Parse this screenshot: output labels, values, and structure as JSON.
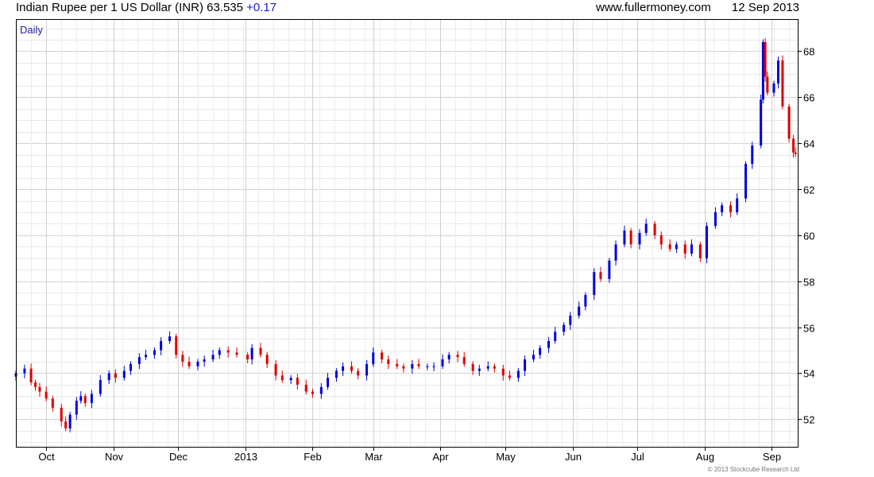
{
  "header": {
    "title": "Indian Rupee per 1 US Dollar (INR) 63.535",
    "change": "+0.17",
    "site": "www.fullermoney.com",
    "date": "12 Sep 2013"
  },
  "footer": {
    "copyright": "© 2013 Stockcube Research Ltd"
  },
  "colors": {
    "up": "#0000dd",
    "down": "#dd0000",
    "grid": "#d8d8d8",
    "label": "#2222aa"
  },
  "chart_data": {
    "type": "candlestick",
    "period_label": "Daily",
    "ylim": [
      50.8,
      69.4
    ],
    "y_ticks": [
      52,
      54,
      56,
      58,
      60,
      62,
      64,
      66,
      68
    ],
    "x_range": [
      "2012-09-17",
      "2013-09-13"
    ],
    "month_ticks": [
      {
        "date": "2012-10-01",
        "label": "Oct"
      },
      {
        "date": "2012-11-01",
        "label": "Nov"
      },
      {
        "date": "2012-12-01",
        "label": "Dec"
      },
      {
        "date": "2013-01-01",
        "label": "2013"
      },
      {
        "date": "2013-02-01",
        "label": "Feb"
      },
      {
        "date": "2013-03-01",
        "label": "Mar"
      },
      {
        "date": "2013-04-01",
        "label": "Apr"
      },
      {
        "date": "2013-05-01",
        "label": "May"
      },
      {
        "date": "2013-06-01",
        "label": "Jun"
      },
      {
        "date": "2013-07-01",
        "label": "Jul"
      },
      {
        "date": "2013-08-01",
        "label": "Aug"
      },
      {
        "date": "2013-09-01",
        "label": "Sep"
      }
    ],
    "series": [
      {
        "date": "2012-09-17",
        "close": 54.0
      },
      {
        "date": "2012-09-21",
        "close": 54.2
      },
      {
        "date": "2012-09-24",
        "close": 53.6
      },
      {
        "date": "2012-09-26",
        "close": 53.4
      },
      {
        "date": "2012-09-28",
        "close": 53.2
      },
      {
        "date": "2012-10-01",
        "close": 52.9
      },
      {
        "date": "2012-10-04",
        "close": 52.5
      },
      {
        "date": "2012-10-08",
        "close": 51.9
      },
      {
        "date": "2012-10-10",
        "close": 51.6
      },
      {
        "date": "2012-10-12",
        "close": 52.2
      },
      {
        "date": "2012-10-15",
        "close": 52.8
      },
      {
        "date": "2012-10-17",
        "close": 53.0
      },
      {
        "date": "2012-10-19",
        "close": 52.7
      },
      {
        "date": "2012-10-22",
        "close": 53.1
      },
      {
        "date": "2012-10-26",
        "close": 53.7
      },
      {
        "date": "2012-10-30",
        "close": 54.0
      },
      {
        "date": "2012-11-02",
        "close": 53.8
      },
      {
        "date": "2012-11-06",
        "close": 54.1
      },
      {
        "date": "2012-11-09",
        "close": 54.4
      },
      {
        "date": "2012-11-13",
        "close": 54.7
      },
      {
        "date": "2012-11-16",
        "close": 54.8
      },
      {
        "date": "2012-11-20",
        "close": 55.0
      },
      {
        "date": "2012-11-23",
        "close": 55.4
      },
      {
        "date": "2012-11-27",
        "close": 55.6
      },
      {
        "date": "2012-11-30",
        "close": 54.8
      },
      {
        "date": "2012-12-03",
        "close": 54.5
      },
      {
        "date": "2012-12-06",
        "close": 54.3
      },
      {
        "date": "2012-12-10",
        "close": 54.5
      },
      {
        "date": "2012-12-13",
        "close": 54.6
      },
      {
        "date": "2012-12-17",
        "close": 54.8
      },
      {
        "date": "2012-12-20",
        "close": 55.0
      },
      {
        "date": "2012-12-24",
        "close": 54.9
      },
      {
        "date": "2012-12-28",
        "close": 54.8
      },
      {
        "date": "2013-01-02",
        "close": 54.6
      },
      {
        "date": "2013-01-04",
        "close": 55.1
      },
      {
        "date": "2013-01-08",
        "close": 54.8
      },
      {
        "date": "2013-01-11",
        "close": 54.4
      },
      {
        "date": "2013-01-15",
        "close": 53.9
      },
      {
        "date": "2013-01-18",
        "close": 53.7
      },
      {
        "date": "2013-01-22",
        "close": 53.8
      },
      {
        "date": "2013-01-25",
        "close": 53.5
      },
      {
        "date": "2013-01-29",
        "close": 53.2
      },
      {
        "date": "2013-02-01",
        "close": 53.1
      },
      {
        "date": "2013-02-05",
        "close": 53.4
      },
      {
        "date": "2013-02-08",
        "close": 53.8
      },
      {
        "date": "2013-02-12",
        "close": 54.1
      },
      {
        "date": "2013-02-15",
        "close": 54.3
      },
      {
        "date": "2013-02-19",
        "close": 54.1
      },
      {
        "date": "2013-02-22",
        "close": 53.9
      },
      {
        "date": "2013-02-26",
        "close": 54.4
      },
      {
        "date": "2013-03-01",
        "close": 54.9
      },
      {
        "date": "2013-03-05",
        "close": 54.6
      },
      {
        "date": "2013-03-08",
        "close": 54.4
      },
      {
        "date": "2013-03-12",
        "close": 54.3
      },
      {
        "date": "2013-03-15",
        "close": 54.2
      },
      {
        "date": "2013-03-19",
        "close": 54.4
      },
      {
        "date": "2013-03-22",
        "close": 54.3
      },
      {
        "date": "2013-03-26",
        "close": 54.3
      },
      {
        "date": "2013-03-29",
        "close": 54.3
      },
      {
        "date": "2013-04-02",
        "close": 54.6
      },
      {
        "date": "2013-04-05",
        "close": 54.8
      },
      {
        "date": "2013-04-09",
        "close": 54.7
      },
      {
        "date": "2013-04-12",
        "close": 54.4
      },
      {
        "date": "2013-04-16",
        "close": 54.1
      },
      {
        "date": "2013-04-19",
        "close": 54.2
      },
      {
        "date": "2013-04-23",
        "close": 54.3
      },
      {
        "date": "2013-04-26",
        "close": 54.2
      },
      {
        "date": "2013-04-30",
        "close": 53.9
      },
      {
        "date": "2013-05-03",
        "close": 53.8
      },
      {
        "date": "2013-05-07",
        "close": 54.1
      },
      {
        "date": "2013-05-10",
        "close": 54.6
      },
      {
        "date": "2013-05-14",
        "close": 54.8
      },
      {
        "date": "2013-05-17",
        "close": 55.1
      },
      {
        "date": "2013-05-21",
        "close": 55.4
      },
      {
        "date": "2013-05-24",
        "close": 55.8
      },
      {
        "date": "2013-05-28",
        "close": 56.1
      },
      {
        "date": "2013-05-31",
        "close": 56.5
      },
      {
        "date": "2013-06-04",
        "close": 56.9
      },
      {
        "date": "2013-06-07",
        "close": 57.4
      },
      {
        "date": "2013-06-11",
        "close": 58.4
      },
      {
        "date": "2013-06-14",
        "close": 58.1
      },
      {
        "date": "2013-06-18",
        "close": 58.9
      },
      {
        "date": "2013-06-21",
        "close": 59.6
      },
      {
        "date": "2013-06-25",
        "close": 60.2
      },
      {
        "date": "2013-06-28",
        "close": 59.6
      },
      {
        "date": "2013-07-02",
        "close": 60.1
      },
      {
        "date": "2013-07-05",
        "close": 60.5
      },
      {
        "date": "2013-07-09",
        "close": 60.0
      },
      {
        "date": "2013-07-12",
        "close": 59.6
      },
      {
        "date": "2013-07-16",
        "close": 59.4
      },
      {
        "date": "2013-07-19",
        "close": 59.6
      },
      {
        "date": "2013-07-23",
        "close": 59.2
      },
      {
        "date": "2013-07-26",
        "close": 59.6
      },
      {
        "date": "2013-07-30",
        "close": 59.0
      },
      {
        "date": "2013-08-02",
        "close": 60.4
      },
      {
        "date": "2013-08-06",
        "close": 61.0
      },
      {
        "date": "2013-08-09",
        "close": 61.3
      },
      {
        "date": "2013-08-13",
        "close": 61.0
      },
      {
        "date": "2013-08-16",
        "close": 61.6
      },
      {
        "date": "2013-08-20",
        "close": 63.1
      },
      {
        "date": "2013-08-23",
        "close": 63.9
      },
      {
        "date": "2013-08-27",
        "close": 65.9
      },
      {
        "date": "2013-08-28",
        "close": 68.4
      },
      {
        "date": "2013-08-29",
        "close": 66.9
      },
      {
        "date": "2013-08-30",
        "close": 66.2
      },
      {
        "date": "2013-09-02",
        "close": 66.6
      },
      {
        "date": "2013-09-04",
        "close": 67.6
      },
      {
        "date": "2013-09-06",
        "close": 65.6
      },
      {
        "date": "2013-09-09",
        "close": 64.2
      },
      {
        "date": "2013-09-11",
        "close": 63.6
      },
      {
        "date": "2013-09-12",
        "close": 63.535
      }
    ]
  }
}
